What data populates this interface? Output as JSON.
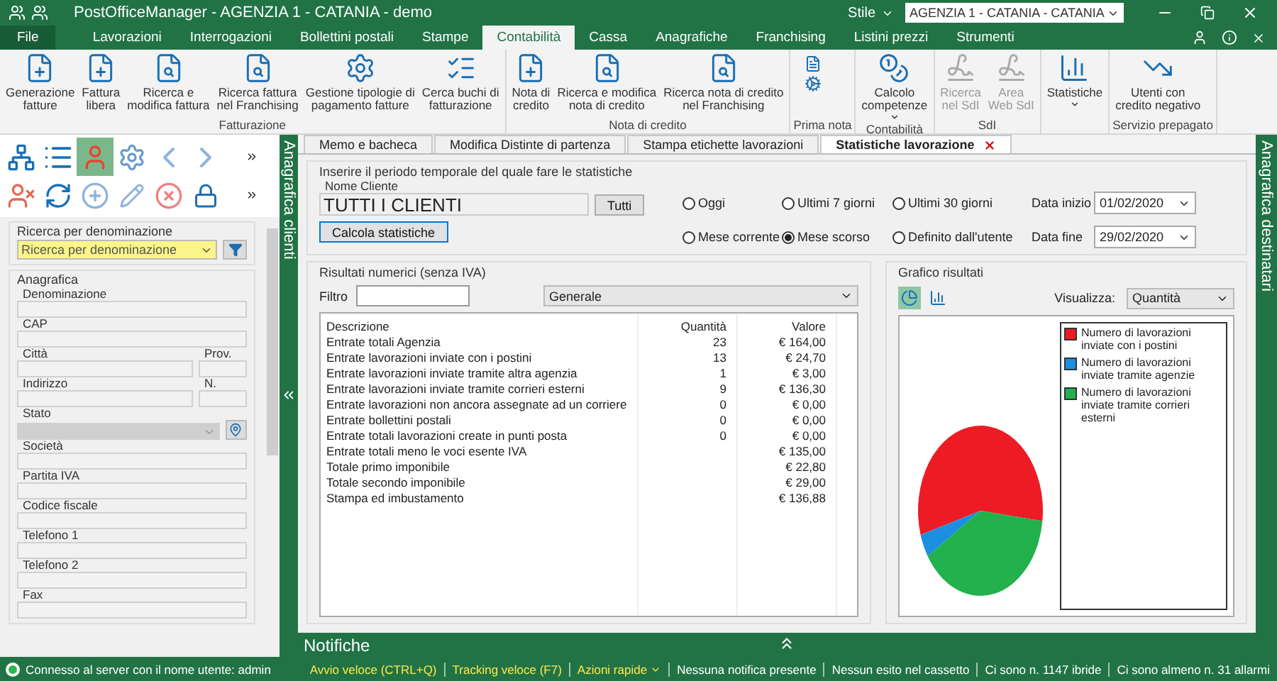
{
  "window": {
    "title": "PostOfficeManager - AGENZIA 1 - CATANIA - demo",
    "style_label": "Stile",
    "agency": "AGENZIA 1 - CATANIA - CATANIA"
  },
  "menu_tabs": [
    {
      "label": "File",
      "kind": "file",
      "selected": false
    },
    {
      "label": "Lavorazioni",
      "kind": "tab",
      "selected": false
    },
    {
      "label": "Interrogazioni",
      "kind": "tab",
      "selected": false
    },
    {
      "label": "Bollettini postali",
      "kind": "tab",
      "selected": false
    },
    {
      "label": "Stampe",
      "kind": "tab",
      "selected": false
    },
    {
      "label": "Contabilità",
      "kind": "tab",
      "selected": true
    },
    {
      "label": "Cassa",
      "kind": "tab",
      "selected": false
    },
    {
      "label": "Anagrafiche",
      "kind": "tab",
      "selected": false
    },
    {
      "label": "Franchising",
      "kind": "tab",
      "selected": false
    },
    {
      "label": "Listini prezzi",
      "kind": "tab",
      "selected": false
    },
    {
      "label": "Strumenti",
      "kind": "tab",
      "selected": false
    }
  ],
  "ribbon": [
    {
      "label": "Fatturazione",
      "buttons": [
        {
          "label": "Generazione\nfatture",
          "kind": "add",
          "disabled": false
        },
        {
          "label": "Fattura\nlibera",
          "kind": "add",
          "disabled": false
        },
        {
          "label": "Ricerca e\nmodifica fattura",
          "kind": "search",
          "disabled": false
        },
        {
          "label": "Ricerca fattura\nnel Franchising",
          "kind": "search",
          "disabled": false
        },
        {
          "label": "Gestione tipologie di\npagamento fatture",
          "kind": "settings",
          "disabled": false
        },
        {
          "label": "Cerca buchi di\nfatturazione",
          "kind": "list",
          "disabled": false
        }
      ]
    },
    {
      "label": "Nota di credito",
      "buttons": [
        {
          "label": "Nota di\ncredito",
          "kind": "add",
          "disabled": false
        },
        {
          "label": "Ricerca e modifica\nnota di credito",
          "kind": "search",
          "disabled": false
        },
        {
          "label": "Ricerca nota di credito\nnel Franchising",
          "kind": "search",
          "disabled": false
        }
      ]
    },
    {
      "label": "Prima nota",
      "buttons": [
        {
          "kind": "pair"
        }
      ]
    },
    {
      "label": "Contabilità",
      "buttons": [
        {
          "label": "Calcolo\ncompetenze",
          "kind": "coin",
          "disabled": false,
          "dropdown": true
        }
      ]
    },
    {
      "label": "SdI",
      "buttons": [
        {
          "label": "Ricerca\nnel SdI",
          "kind": "sdi",
          "disabled": true
        },
        {
          "label": "Area\nWeb SdI",
          "kind": "sdi",
          "disabled": true
        }
      ]
    },
    {
      "buttons": [
        {
          "label": "Statistiche",
          "kind": "chart",
          "disabled": false,
          "dropdown": true
        }
      ]
    },
    {
      "label": "Servizio prepagato",
      "buttons": [
        {
          "label": "Utenti con\ncredito negativo",
          "kind": "trend",
          "disabled": false
        }
      ]
    }
  ],
  "left_panel": {
    "side_title": "Anagrafica clienti",
    "search": {
      "legend": "Ricerca per denominazione",
      "value": "Ricerca per denominazione"
    },
    "form_legend": "Anagrafica",
    "fields": [
      {
        "label": "Denominazione",
        "kind": "text"
      },
      {
        "label": "CAP",
        "kind": "text"
      },
      {
        "label": "Città",
        "kind": "pair",
        "side_label": "Prov."
      },
      {
        "label": "Indirizzo",
        "kind": "pair",
        "side_label": "N."
      },
      {
        "label": "Stato",
        "kind": "combo"
      },
      {
        "label": "Società",
        "kind": "text"
      },
      {
        "label": "Partita IVA",
        "kind": "text"
      },
      {
        "label": "Codice fiscale",
        "kind": "text"
      },
      {
        "label": "Telefono 1",
        "kind": "text"
      },
      {
        "label": "Telefono 2",
        "kind": "text"
      },
      {
        "label": "Fax",
        "kind": "text"
      }
    ]
  },
  "right_panel": {
    "side_title": "Anagrafica destinatari"
  },
  "doc_tabs": [
    {
      "label": "Memo e bacheca",
      "selected": false
    },
    {
      "label": "Modifica Distinte di partenza",
      "selected": false
    },
    {
      "label": "Stampa etichette lavorazioni",
      "selected": false
    },
    {
      "label": "Statistiche lavorazione",
      "selected": true
    }
  ],
  "period": {
    "legend": "Inserire il periodo temporale del quale fare le statistiche",
    "client_label": "Nome Cliente",
    "client_value": "TUTTI I CLIENTI",
    "all_button": "Tutti",
    "compute_button": "Calcola statistiche",
    "options": [
      {
        "label": "Oggi",
        "selected": false
      },
      {
        "label": "Ultimi 7 giorni",
        "selected": false
      },
      {
        "label": "Ultimi 30 giorni",
        "selected": false
      },
      {
        "label": "Mese corrente",
        "selected": false
      },
      {
        "label": "Mese scorso",
        "selected": true
      },
      {
        "label": "Definito dall'utente",
        "selected": false
      }
    ],
    "start_label": "Data inizio",
    "start_value": "01/02/2020",
    "end_label": "Data fine",
    "end_value": "29/02/2020"
  },
  "results": {
    "legend": "Risultati numerici (senza IVA)",
    "filter_label": "Filtro",
    "category": "Generale",
    "columns": [
      "Descrizione",
      "Quantità",
      "Valore"
    ],
    "rows": [
      [
        "Entrate totali Agenzia",
        "23",
        "€ 164,00"
      ],
      [
        "Entrate lavorazioni inviate con i postini",
        "13",
        "€ 24,70"
      ],
      [
        "Entrate lavorazioni inviate tramite altra agenzia",
        "1",
        "€ 3,00"
      ],
      [
        "Entrate lavorazioni inviate tramite corrieri esterni",
        "9",
        "€ 136,30"
      ],
      [
        "Entrate lavorazioni non ancora assegnate ad un corriere",
        "0",
        "€ 0,00"
      ],
      [
        "Entrate bollettini postali",
        "0",
        "€ 0,00"
      ],
      [
        "Entrate totali lavorazioni create in punti posta",
        "0",
        "€ 0,00"
      ],
      [
        "Entrate totali meno le voci esente IVA",
        "",
        "€ 135,00"
      ],
      [
        "Totale primo imponibile",
        "",
        "€ 22,80"
      ],
      [
        "Totale secondo imponibile",
        "",
        "€ 29,00"
      ],
      [
        "Stampa ed imbustamento",
        "",
        "€ 136,88"
      ]
    ]
  },
  "chart": {
    "legend": "Grafico risultati",
    "views": [
      {
        "kind": "pie",
        "selected": true
      },
      {
        "kind": "bar",
        "selected": false
      }
    ],
    "show_label": "Visualizza:",
    "show_value": "Quantità",
    "chart_data": {
      "type": "pie",
      "categories": [
        "Numero di lavorazioni inviate con i postini",
        "Numero di lavorazioni inviate tramite agenzie",
        "Numero di lavorazioni inviate tramite corrieri esterni"
      ],
      "series": [
        {
          "values": [
            56.5,
            4.4,
            39.1
          ]
        }
      ],
      "colors": [
        "#ed1c24",
        "#1d8fe1",
        "#22b14c"
      ]
    }
  },
  "notifications": {
    "title": "Notifiche"
  },
  "status_bar": {
    "connection": "Connesso al server con il nome utente: admin",
    "items": [
      {
        "text": "Avvio veloce (CTRL+Q)",
        "kind": "link"
      },
      {
        "text": "Tracking veloce (F7)",
        "kind": "link"
      },
      {
        "text": "Azioni rapide",
        "kind": "menu"
      },
      {
        "text": "Nessuna notifica presente",
        "kind": "info"
      },
      {
        "text": "Nessun esito nel cassetto",
        "kind": "info"
      },
      {
        "text": "Ci sono n. 1147 ibride",
        "kind": "info"
      },
      {
        "text": "Ci sono almeno n. 31 allarmi",
        "kind": "info"
      }
    ]
  }
}
